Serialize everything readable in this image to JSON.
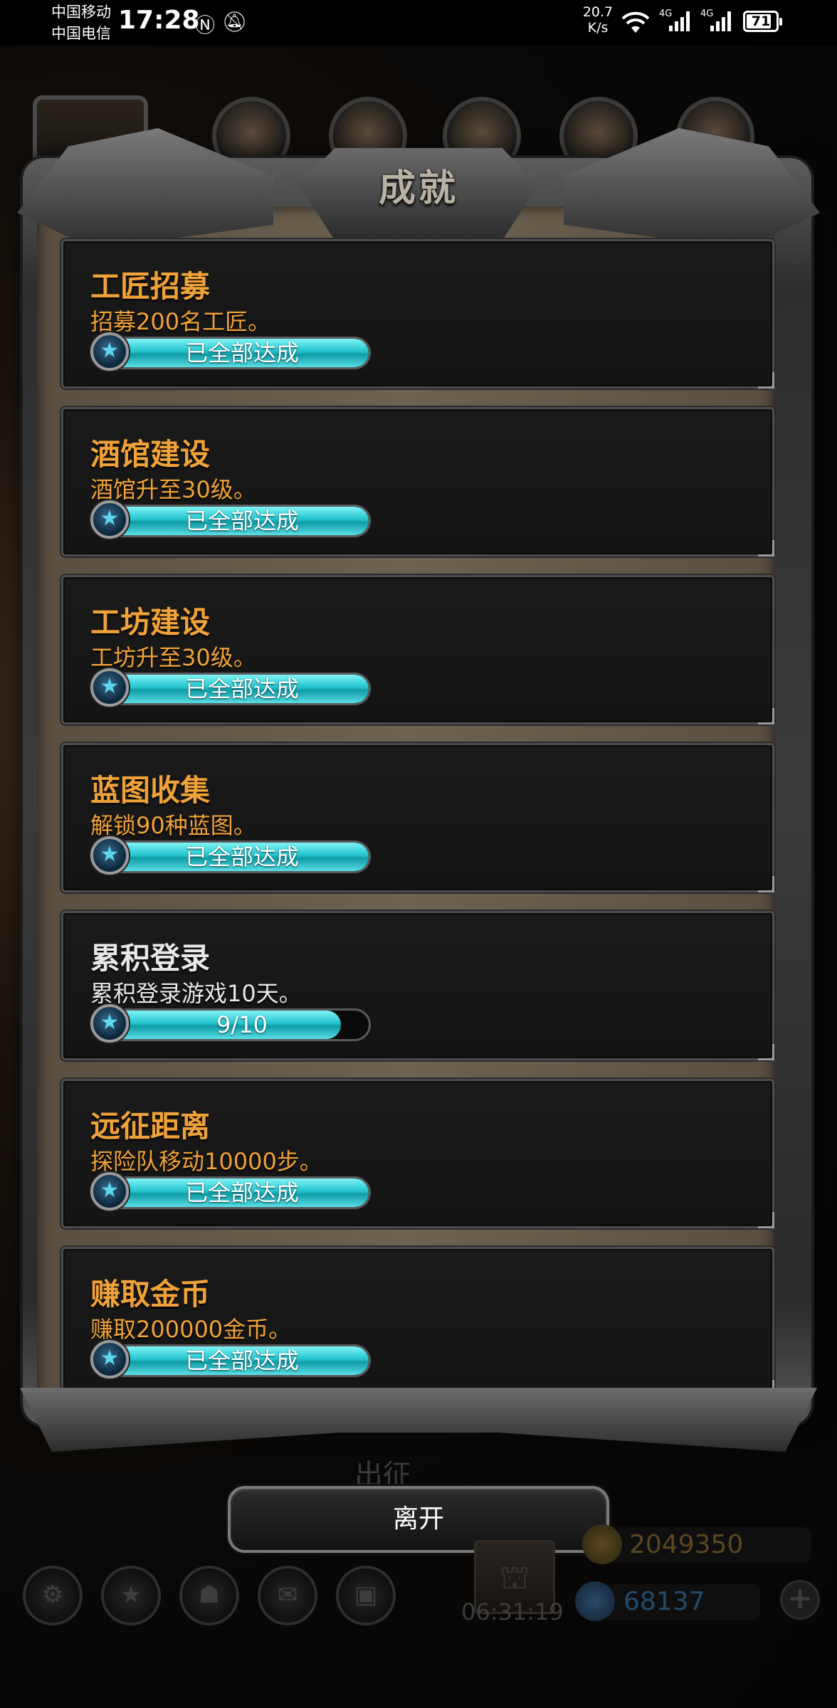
{
  "status_bar": {
    "carrier_1": "中国移动",
    "carrier_2": "中国电信",
    "time": "17:28",
    "net_speed_value": "20.7",
    "net_speed_unit": "K/s",
    "signal_1_tag": "4G",
    "signal_2_tag": "4G",
    "battery": "71"
  },
  "dialog": {
    "title": "成就",
    "leave_label": "离开",
    "background_label": "出征"
  },
  "achievements": [
    {
      "title": "工匠招募",
      "desc": "招募200名工匠。",
      "status": "已全部达成",
      "progress": 1.0,
      "highlight": true
    },
    {
      "title": "酒馆建设",
      "desc": "酒馆升至30级。",
      "status": "已全部达成",
      "progress": 1.0,
      "highlight": true
    },
    {
      "title": "工坊建设",
      "desc": "工坊升至30级。",
      "status": "已全部达成",
      "progress": 1.0,
      "highlight": true
    },
    {
      "title": "蓝图收集",
      "desc": "解锁90种蓝图。",
      "status": "已全部达成",
      "progress": 1.0,
      "highlight": true
    },
    {
      "title": "累积登录",
      "desc": "累积登录游戏10天。",
      "status": "9/10",
      "progress": 0.9,
      "highlight": false
    },
    {
      "title": "远征距离",
      "desc": "探险队移动10000步。",
      "status": "已全部达成",
      "progress": 1.0,
      "highlight": true
    },
    {
      "title": "赚取金币",
      "desc": "赚取200000金币。",
      "status": "已全部达成",
      "progress": 1.0,
      "highlight": true
    }
  ],
  "hud": {
    "timer": "06:31:19",
    "gold": "2049350",
    "gems": "68137"
  },
  "colors": {
    "title_gold": "#f0a23a",
    "bar_cyan": "#23c3cd",
    "text_white": "#e8e8e8"
  }
}
